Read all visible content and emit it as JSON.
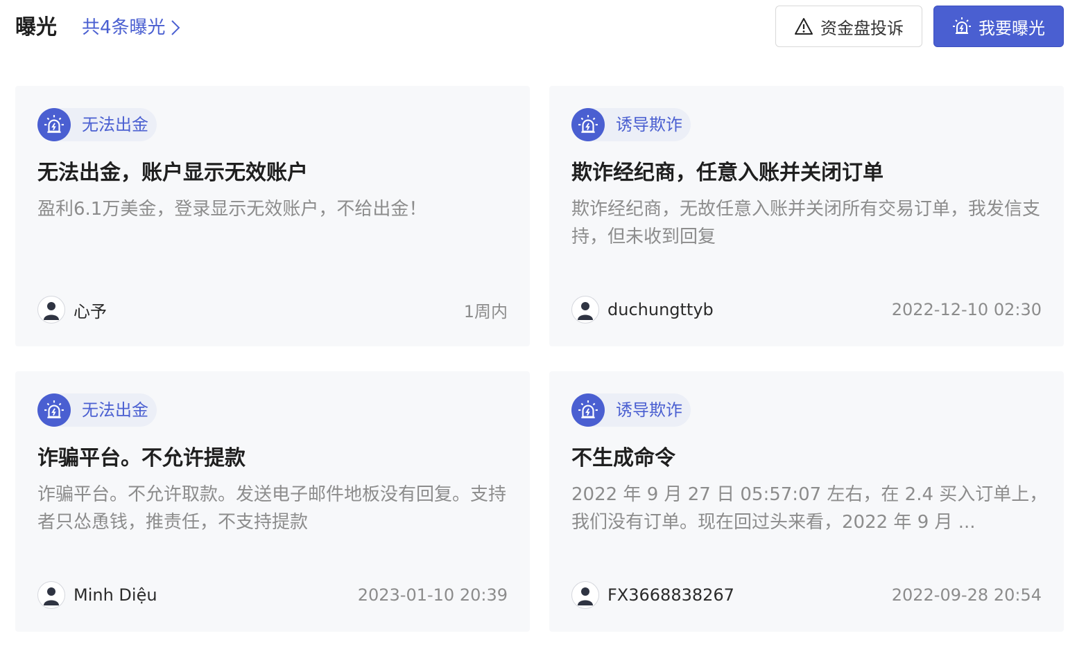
{
  "header": {
    "title": "曝光",
    "count_link": "共4条曝光",
    "complain_button": "资金盘投诉",
    "expose_button": "我要曝光"
  },
  "cards": [
    {
      "tag": "无法出金",
      "title": "无法出金，账户显示无效账户",
      "desc": "盈利6.1万美金，登录显示无效账户，不给出金！",
      "user": "心予",
      "time": "1周内"
    },
    {
      "tag": "诱导欺诈",
      "title": "欺诈经纪商，任意入账并关闭订单",
      "desc": "欺诈经纪商，无故任意入账并关闭所有交易订单，我发信支持，但未收到回复",
      "user": "duchungttyb",
      "time": "2022-12-10 02:30"
    },
    {
      "tag": "无法出金",
      "title": "诈骗平台。不允许提款",
      "desc": "诈骗平台。不允许取款。发送电子邮件地板没有回复。支持者只怂恿钱，推责任，不支持提款",
      "user": "Minh Diệu",
      "time": "2023-01-10 20:39"
    },
    {
      "tag": "诱导欺诈",
      "title": "不生成命令",
      "desc": "2022 年 9 月 27 日 05:57:07 左右，在 2.4 买入订单上，我们没有订单。现在回过头来看，2022 年 9 月 ...",
      "user": "FX3668838267",
      "time": "2022-09-28 20:54"
    }
  ],
  "colors": {
    "accent": "#4a5fd1",
    "card_bg": "#f7f8fa",
    "muted_text": "#8c8c8c"
  },
  "icons": {
    "count_link": "chevron-right-icon",
    "complain_button": "warning-triangle-icon",
    "expose_button": "alarm-siren-icon",
    "tag": "alarm-siren-icon",
    "avatar": "user-avatar-icon"
  }
}
